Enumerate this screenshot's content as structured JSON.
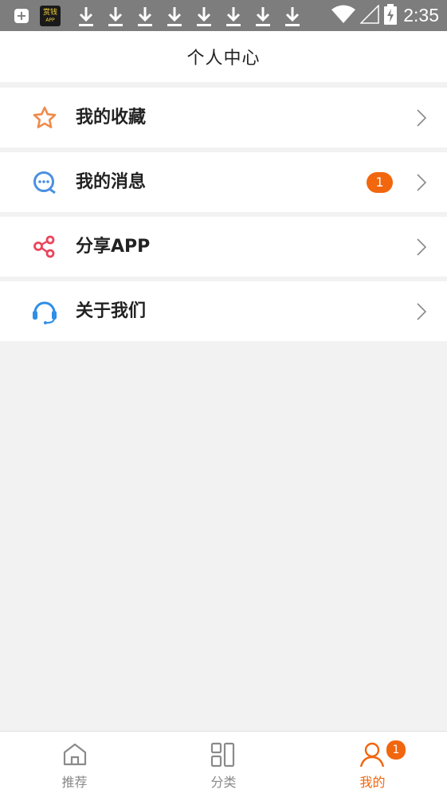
{
  "status_bar": {
    "time": "2:35",
    "app_icon_text_top": "赏钱",
    "app_icon_text_bottom": "APP",
    "icons": [
      "plus-icon",
      "app-icon",
      "download-icon",
      "download-icon",
      "download-icon",
      "download-icon",
      "download-icon",
      "download-icon",
      "download-icon",
      "download-icon",
      "wifi-icon",
      "signal-icon",
      "battery-charging-icon"
    ]
  },
  "header": {
    "title": "个人中心"
  },
  "menu": {
    "items": [
      {
        "label": "我的收藏",
        "icon": "star-icon"
      },
      {
        "label": "我的消息",
        "icon": "message-icon",
        "badge": "1"
      },
      {
        "label": "分享APP",
        "icon": "share-icon"
      },
      {
        "label": "关于我们",
        "icon": "headset-icon"
      }
    ]
  },
  "tabbar": {
    "tabs": [
      {
        "label": "推荐",
        "icon": "home-icon"
      },
      {
        "label": "分类",
        "icon": "category-icon"
      },
      {
        "label": "我的",
        "icon": "user-icon",
        "badge": "1",
        "active": true
      }
    ]
  },
  "colors": {
    "accent": "#f2660e",
    "status_bar": "#7d7d7d",
    "background": "#f2f2f2"
  }
}
